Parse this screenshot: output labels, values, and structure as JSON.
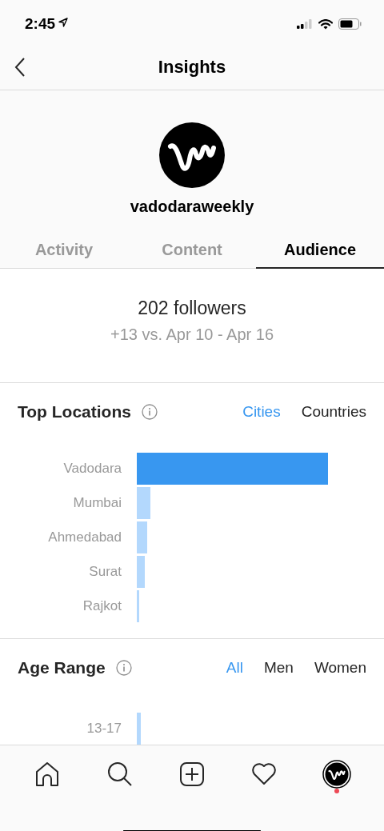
{
  "status_bar": {
    "time": "2:45"
  },
  "header": {
    "title": "Insights"
  },
  "profile": {
    "username": "vadodaraweekly"
  },
  "tabs": [
    {
      "label": "Activity",
      "selected": false
    },
    {
      "label": "Content",
      "selected": false
    },
    {
      "label": "Audience",
      "selected": true
    }
  ],
  "followers": {
    "count": "202 followers",
    "comparison": "+13 vs. Apr 10 - Apr 16"
  },
  "top_locations": {
    "title": "Top Locations",
    "filters": [
      {
        "label": "Cities",
        "selected": true
      },
      {
        "label": "Countries",
        "selected": false
      }
    ],
    "rows": [
      {
        "name": "Vadodara",
        "highlighted": true
      },
      {
        "name": "Mumbai",
        "highlighted": false
      },
      {
        "name": "Ahmedabad",
        "highlighted": false
      },
      {
        "name": "Surat",
        "highlighted": false
      },
      {
        "name": "Rajkot",
        "highlighted": false
      }
    ]
  },
  "age_range": {
    "title": "Age Range",
    "filters": [
      {
        "label": "All",
        "selected": true
      },
      {
        "label": "Men",
        "selected": false
      },
      {
        "label": "Women",
        "selected": false
      }
    ],
    "rows": [
      {
        "name": "13-17",
        "highlighted": false
      }
    ]
  },
  "nav": {
    "items": [
      {
        "kind": "home"
      },
      {
        "kind": "search"
      },
      {
        "kind": "add"
      },
      {
        "kind": "heart"
      },
      {
        "kind": "profile",
        "notification": true
      }
    ]
  }
}
